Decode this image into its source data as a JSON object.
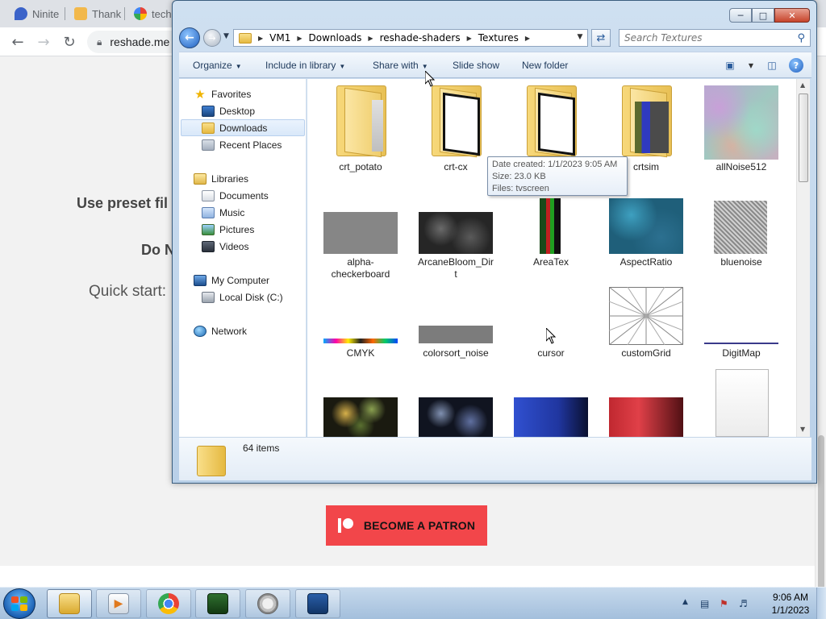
{
  "browser": {
    "tabs": [
      {
        "label": "Ninite"
      },
      {
        "label": "Thank"
      },
      {
        "label": "techn"
      }
    ],
    "address": "reshade.me",
    "page_lines": {
      "line1": "Use preset fil",
      "line2": "Do N",
      "line3": "Quick start:"
    },
    "patron_button": "BECOME A PATRON",
    "colors": {
      "patron": "#f2464a"
    }
  },
  "explorer": {
    "breadcrumb": [
      "VM1",
      "Downloads",
      "reshade-shaders",
      "Textures"
    ],
    "search_placeholder": "Search Textures",
    "commands": {
      "organize": "Organize",
      "include_in_library": "Include in library",
      "share_with": "Share with",
      "slide_show": "Slide show",
      "new_folder": "New folder"
    },
    "nav": {
      "favorites": "Favorites",
      "desktop": "Desktop",
      "downloads": "Downloads",
      "recent_places": "Recent Places",
      "libraries": "Libraries",
      "documents": "Documents",
      "music": "Music",
      "pictures": "Pictures",
      "videos": "Videos",
      "my_computer": "My Computer",
      "local_disk": "Local Disk (C:)",
      "network": "Network"
    },
    "files": {
      "row1": [
        "crt_potato",
        "crt-cx",
        "",
        "crtsim",
        "allNoise512"
      ],
      "row2": [
        "alpha-checkerboard",
        "ArcaneBloom_Dirt",
        "AreaTex",
        "AspectRatio",
        "bluenoise"
      ],
      "row3": [
        "CMYK",
        "colorsort_noise",
        "cursor",
        "customGrid",
        "DigitMap"
      ]
    },
    "tooltip": {
      "date_created": "Date created: 1/1/2023 9:05 AM",
      "size": "Size: 23.0 KB",
      "files": "Files: tvscreen"
    },
    "status": "64 items"
  },
  "taskbar": {
    "time": "9:06 AM",
    "date": "1/1/2023"
  }
}
